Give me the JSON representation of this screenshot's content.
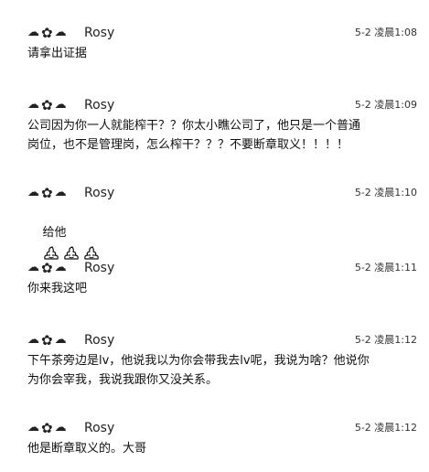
{
  "messages": [
    {
      "sender": "Rosy",
      "time": "5-2 凌晨1:08",
      "text": "请拿出证据"
    },
    {
      "sender": "Rosy",
      "time": "5-2 凌晨1:09",
      "text": "公司因为你一人就能榨干？？你太小瞧公司了，他只是一个普通\n岗位，也不是管理岗，怎么榨干？？？不要断章取义！！！！"
    },
    {
      "sender": "Rosy",
      "time": "5-2 凌晨1:10",
      "text": "给他",
      "emoji": "poop-icon",
      "emoji_count": 3
    },
    {
      "sender": "Rosy",
      "time": "5-2 凌晨1:11",
      "text": "你来我这吧"
    },
    {
      "sender": "Rosy",
      "time": "5-2 凌晨1:12",
      "text": "下午茶旁边是lv，他说我以为你会带我去lv呢，我说为啥？他说你\n为你会宰我，我说我跟你又没关系。"
    },
    {
      "sender": "Rosy",
      "time": "5-2 凌晨1:12",
      "text": "他是断章取义的。大哥"
    }
  ]
}
